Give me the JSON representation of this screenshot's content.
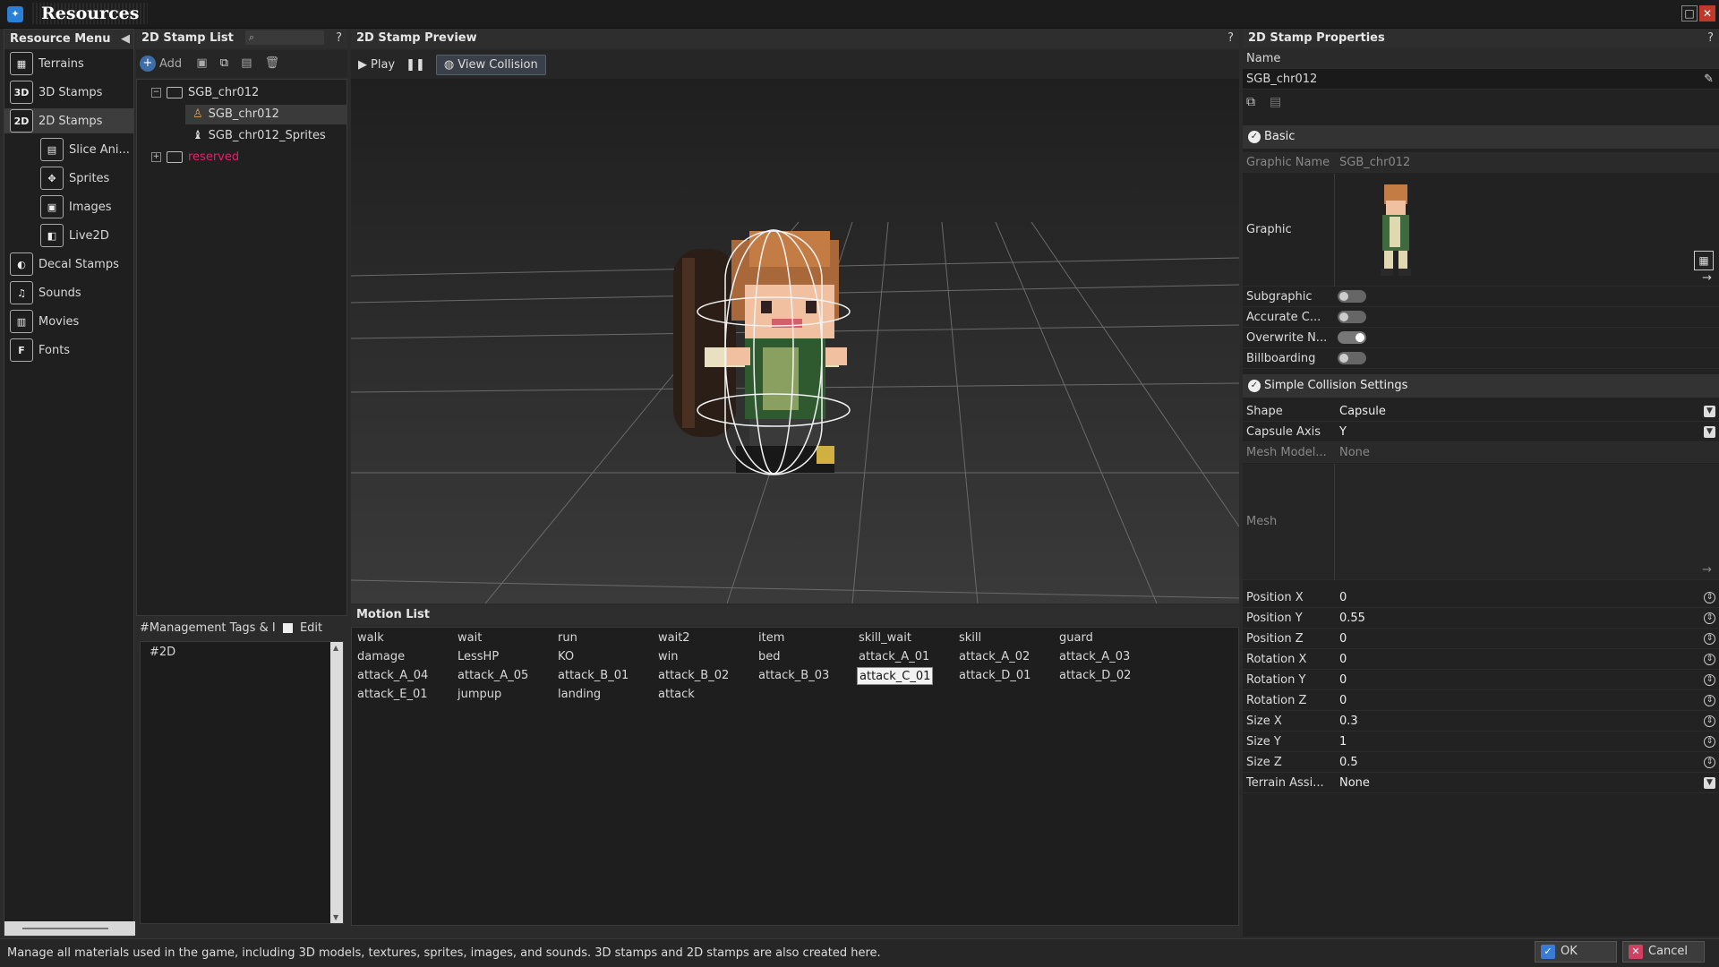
{
  "window": {
    "title": "Resources",
    "logo_glyph": "✦"
  },
  "resource_menu": {
    "title": "Resource Menu",
    "items": [
      {
        "label": "Terrains",
        "icon": "terrain-icon",
        "glyph": "▦"
      },
      {
        "label": "3D Stamps",
        "icon": "3d-stamp-icon",
        "glyph": "3D"
      },
      {
        "label": "2D Stamps",
        "icon": "2d-stamp-icon",
        "glyph": "2D",
        "selected": true
      },
      {
        "label": "Slice Ani...",
        "icon": "slice-animation-icon",
        "glyph": "▤",
        "sub": true
      },
      {
        "label": "Sprites",
        "icon": "sprites-icon",
        "glyph": "✥",
        "sub": true
      },
      {
        "label": "Images",
        "icon": "images-icon",
        "glyph": "▣",
        "sub": true
      },
      {
        "label": "Live2D",
        "icon": "live2d-icon",
        "glyph": "◧",
        "sub": true
      },
      {
        "label": "Decal Stamps",
        "icon": "decal-stamp-icon",
        "glyph": "◐"
      },
      {
        "label": "Sounds",
        "icon": "sounds-icon",
        "glyph": "♫"
      },
      {
        "label": "Movies",
        "icon": "movies-icon",
        "glyph": "▥"
      },
      {
        "label": "Fonts",
        "icon": "fonts-icon",
        "glyph": "F"
      }
    ]
  },
  "stamp_list": {
    "title": "2D Stamp List",
    "help": "?",
    "toolbar": {
      "add_label": "Add"
    },
    "tree": [
      {
        "label": "SGB_chr012",
        "type": "folder",
        "expanded": true
      },
      {
        "label": "SGB_chr012",
        "type": "stamp",
        "selected": true
      },
      {
        "label": "SGB_chr012_Sprites",
        "type": "sprite"
      },
      {
        "label": "reserved",
        "type": "folder",
        "color": "#e0206a"
      }
    ]
  },
  "tags": {
    "title": "#Management Tags & I",
    "edit_label": "Edit Tags",
    "items": [
      "#2D"
    ]
  },
  "preview": {
    "title": "2D Stamp Preview",
    "help": "?",
    "play_label": "Play",
    "view_collision_label": "View Collision"
  },
  "motion_list": {
    "title": "Motion List",
    "items": [
      "walk",
      "wait",
      "run",
      "wait2",
      "item",
      "skill_wait",
      "skill",
      "guard",
      "damage",
      "LessHP",
      "KO",
      "win",
      "bed",
      "attack_A_01",
      "attack_A_02",
      "attack_A_03",
      "attack_A_04",
      "attack_A_05",
      "attack_B_01",
      "attack_B_02",
      "attack_B_03",
      "attack_C_01",
      "attack_D_01",
      "attack_D_02",
      "attack_E_01",
      "jumpup",
      "landing",
      "attack"
    ],
    "selected": "attack_C_01"
  },
  "properties": {
    "title": "2D Stamp Properties",
    "help": "?",
    "name_label": "Name",
    "name_value": "SGB_chr012",
    "basic_section": "Basic",
    "graphic_name_label": "Graphic Name",
    "graphic_name_value": "SGB_chr012",
    "graphic_label": "Graphic",
    "toggles": [
      {
        "label": "Subgraphic",
        "on": false
      },
      {
        "label": "Accurate C...",
        "on": false
      },
      {
        "label": "Overwrite N...",
        "on": true
      },
      {
        "label": "Billboarding",
        "on": false
      }
    ],
    "collision_section": "Simple Collision Settings",
    "shape_label": "Shape",
    "shape_value": "Capsule",
    "axis_label": "Capsule Axis",
    "axis_value": "Y",
    "mesh_model_label": "Mesh Model...",
    "mesh_model_value": "None",
    "mesh_label": "Mesh",
    "numeric": [
      {
        "label": "Position X",
        "value": "0"
      },
      {
        "label": "Position Y",
        "value": "0.55"
      },
      {
        "label": "Position Z",
        "value": "0"
      },
      {
        "label": "Rotation X",
        "value": "0"
      },
      {
        "label": "Rotation Y",
        "value": "0"
      },
      {
        "label": "Rotation Z",
        "value": "0"
      },
      {
        "label": "Size X",
        "value": "0.3"
      },
      {
        "label": "Size Y",
        "value": "1"
      },
      {
        "label": "Size Z",
        "value": "0.5"
      }
    ],
    "terrain_label": "Terrain Assi...",
    "terrain_value": "None"
  },
  "status": {
    "message": "Manage all materials used in the game, including 3D models, textures, sprites, images, and sounds. 3D stamps and 2D stamps are also created here."
  },
  "dialog": {
    "ok_label": "OK",
    "cancel_label": "Cancel"
  }
}
